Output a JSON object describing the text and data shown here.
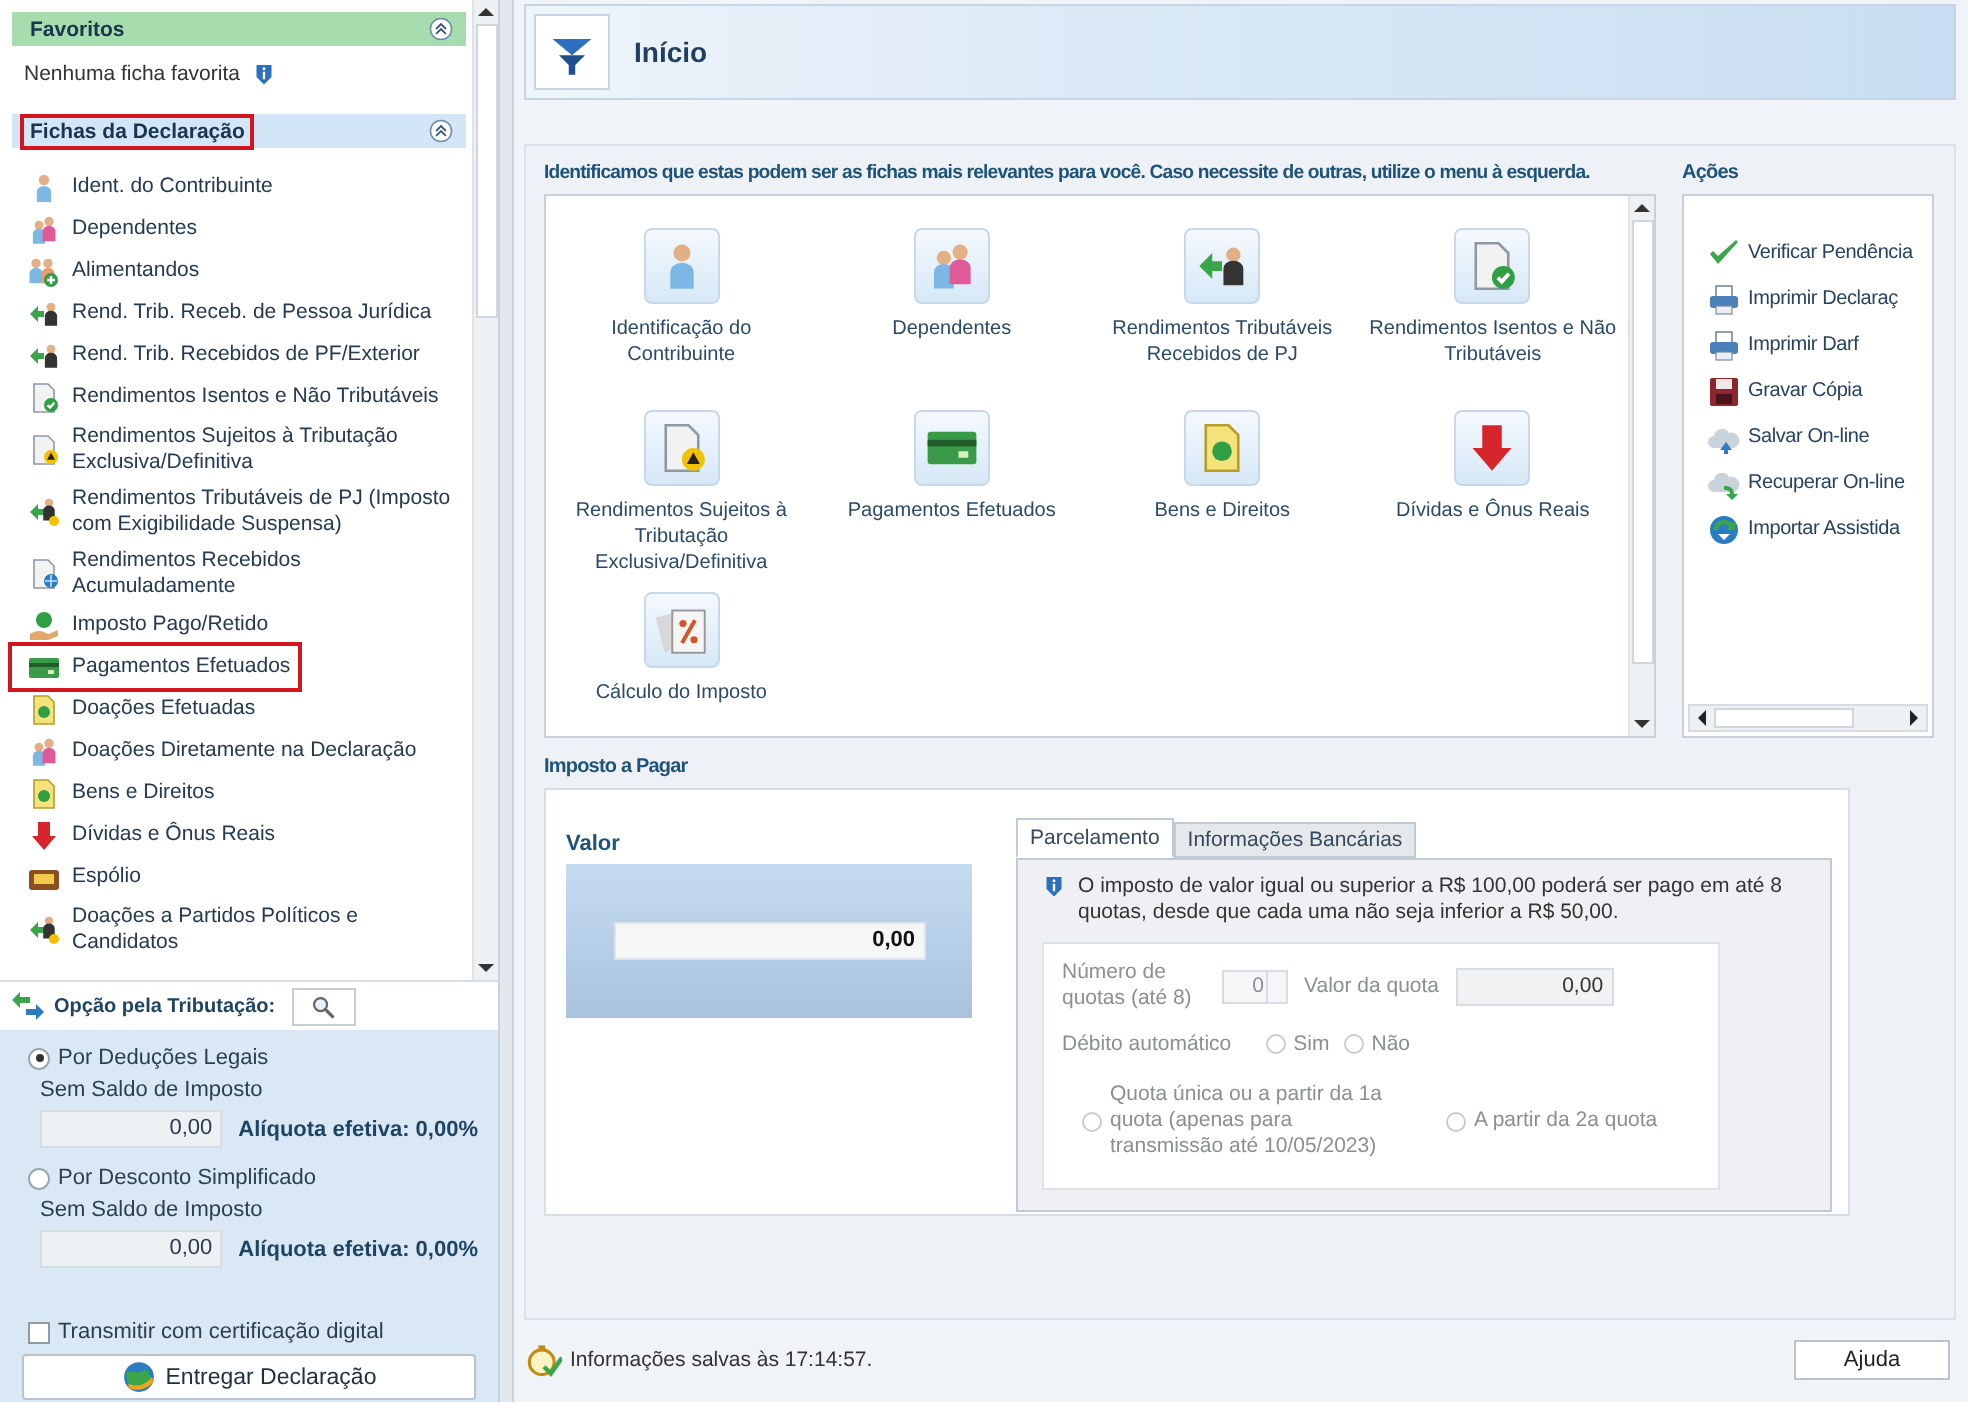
{
  "favorites": {
    "title": "Favoritos",
    "empty_text": "Nenhuma ficha favorita"
  },
  "sheets": {
    "title": "Fichas da Declaração",
    "highlighted": true,
    "items": [
      {
        "label": "Ident. do Contribuinte",
        "highlighted": false
      },
      {
        "label": "Dependentes",
        "highlighted": false
      },
      {
        "label": "Alimentandos",
        "highlighted": false
      },
      {
        "label": "Rend. Trib. Receb. de Pessoa Jurídica",
        "highlighted": false
      },
      {
        "label": "Rend. Trib. Recebidos de PF/Exterior",
        "highlighted": false
      },
      {
        "label": "Rendimentos Isentos e Não Tributáveis",
        "highlighted": false
      },
      {
        "label": "Rendimentos Sujeitos à Tributação Exclusiva/Definitiva",
        "highlighted": false
      },
      {
        "label": "Rendimentos Tributáveis de PJ (Imposto com Exigibilidade Suspensa)",
        "highlighted": false
      },
      {
        "label": "Rendimentos Recebidos Acumuladamente",
        "highlighted": false
      },
      {
        "label": "Imposto Pago/Retido",
        "highlighted": false
      },
      {
        "label": "Pagamentos Efetuados",
        "highlighted": true
      },
      {
        "label": "Doações Efetuadas",
        "highlighted": false
      },
      {
        "label": "Doações Diretamente na Declaração",
        "highlighted": false
      },
      {
        "label": "Bens e Direitos",
        "highlighted": false
      },
      {
        "label": "Dívidas e Ônus Reais",
        "highlighted": false
      },
      {
        "label": "Espólio",
        "highlighted": false
      },
      {
        "label": "Doações a Partidos Políticos e Candidatos",
        "highlighted": false
      }
    ]
  },
  "taxation_option": {
    "label": "Opção pela Tributação:",
    "options": [
      {
        "label": "Por Deduções Legais",
        "selected": true,
        "status": "Sem Saldo de Imposto",
        "value": "0,00",
        "rate": "Alíquota efetiva: 0,00%"
      },
      {
        "label": "Por Desconto Simplificado",
        "selected": false,
        "status": "Sem Saldo de Imposto",
        "value": "0,00",
        "rate": "Alíquota efetiva: 0,00%"
      }
    ]
  },
  "digital_certificate": {
    "label": "Transmitir com certificação digital",
    "checked": false
  },
  "submit_button": "Entregar Declaração",
  "page": {
    "title": "Início"
  },
  "suggestions": {
    "intro": "Identificamos que estas podem ser as fichas mais relevantes para você. Caso necessite de outras, utilize o menu à esquerda.",
    "cards": [
      {
        "label": "Identificação do Contribuinte"
      },
      {
        "label": "Dependentes"
      },
      {
        "label": "Rendimentos Tributáveis Recebidos de PJ"
      },
      {
        "label": "Rendimentos Isentos e Não Tributáveis"
      },
      {
        "label": "Rendimentos Sujeitos à Tributação Exclusiva/Definitiva"
      },
      {
        "label": "Pagamentos Efetuados"
      },
      {
        "label": "Bens e Direitos"
      },
      {
        "label": "Dívidas e Ônus Reais"
      },
      {
        "label": "Cálculo do Imposto"
      }
    ]
  },
  "actions": {
    "title": "Ações",
    "items": [
      "Verificar Pendência",
      "Imprimir Declaraç",
      "Imprimir Darf",
      "Gravar Cópia",
      "Salvar On-line",
      "Recuperar On-line",
      "Importar Assistida"
    ]
  },
  "tax_due": {
    "title": "Imposto a Pagar",
    "value_label": "Valor",
    "value": "0,00",
    "tabs": [
      {
        "label": "Parcelamento",
        "selected": true
      },
      {
        "label": "Informações Bancárias",
        "selected": false
      }
    ],
    "notice": "O imposto de valor igual ou superior a R$ 100,00 poderá ser pago em até 8 quotas, desde que cada uma não seja inferior a R$ 50,00.",
    "installments_label": "Número de quotas (até 8)",
    "installments": "0",
    "quota_label": "Valor da quota",
    "quota_value": "0,00",
    "auto_debit_label": "Débito automático",
    "disabled": true,
    "auto_debit_options": [
      {
        "label": "Sim",
        "selected": false
      },
      {
        "label": "Não",
        "selected": false
      }
    ],
    "start_options": [
      {
        "label": "Quota única ou a partir da 1a quota (apenas para transmissão até 10/05/2023)",
        "selected": false
      },
      {
        "label": "A partir da 2a quota",
        "selected": false
      }
    ]
  },
  "status": {
    "text": "Informações salvas às 17:14:57."
  },
  "help_button": "Ajuda"
}
